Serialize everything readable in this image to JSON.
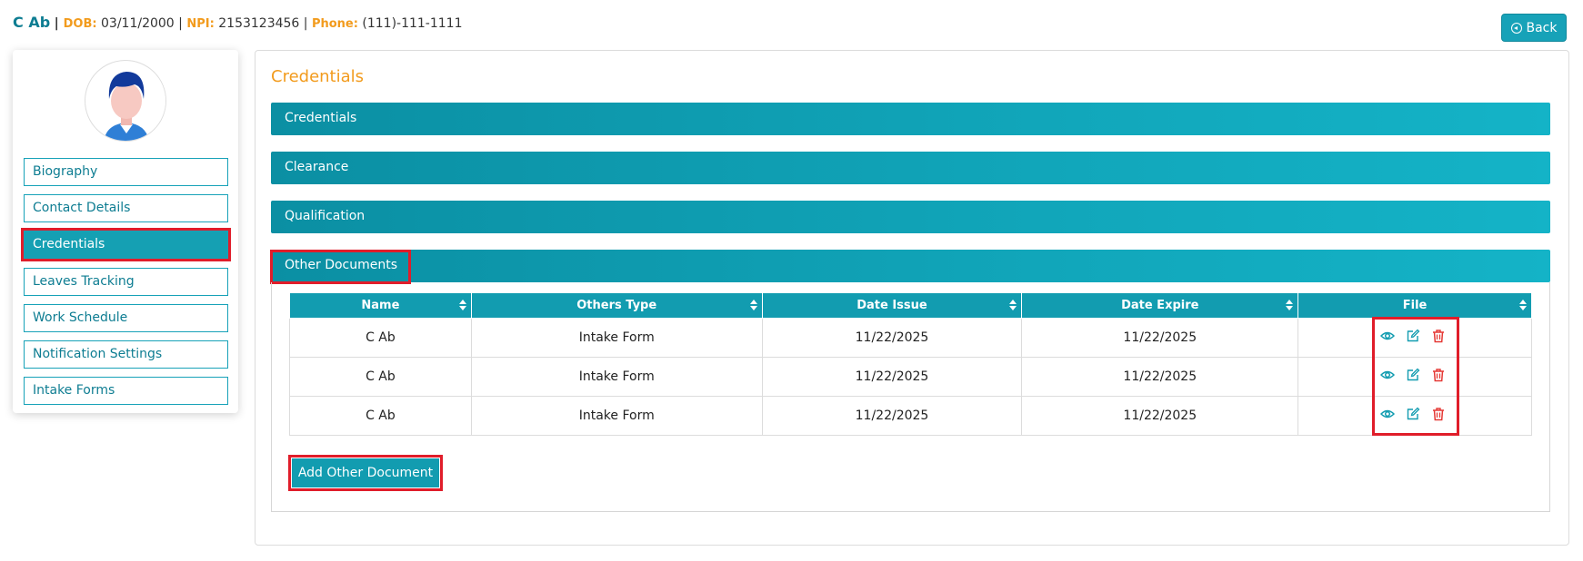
{
  "header": {
    "patient_name": "C Ab",
    "dob_label": "DOB:",
    "dob_value": "03/11/2000",
    "npi_label": "NPI:",
    "npi_value": "2153123456",
    "phone_label": "Phone:",
    "phone_value": "(111)-111-1111",
    "back_label": "Back"
  },
  "sidebar": {
    "items": [
      {
        "label": "Biography"
      },
      {
        "label": "Contact Details"
      },
      {
        "label": "Credentials"
      },
      {
        "label": "Leaves Tracking"
      },
      {
        "label": "Work Schedule"
      },
      {
        "label": "Notification Settings"
      },
      {
        "label": "Intake Forms"
      }
    ],
    "active_index": 2
  },
  "main": {
    "title": "Credentials",
    "accordions": [
      {
        "label": "Credentials"
      },
      {
        "label": "Clearance"
      },
      {
        "label": "Qualification"
      },
      {
        "label": "Other Documents"
      }
    ],
    "table": {
      "columns": [
        "Name",
        "Others Type",
        "Date Issue",
        "Date Expire",
        "File"
      ],
      "rows": [
        {
          "name": "C Ab",
          "type": "Intake Form",
          "issue": "11/22/2025",
          "expire": "11/22/2025"
        },
        {
          "name": "C Ab",
          "type": "Intake Form",
          "issue": "11/22/2025",
          "expire": "11/22/2025"
        },
        {
          "name": "C Ab",
          "type": "Intake Form",
          "issue": "11/22/2025",
          "expire": "11/22/2025"
        }
      ]
    },
    "add_button_label": "Add Other Document"
  },
  "colors": {
    "accent_teal": "#17a2b8",
    "label_orange": "#f29b1d",
    "highlight_red": "#e01d2a",
    "delete_red": "#e53935"
  },
  "icons": [
    "back-circle-icon",
    "eye-icon",
    "edit-icon",
    "trash-icon",
    "sort-icon",
    "avatar"
  ]
}
